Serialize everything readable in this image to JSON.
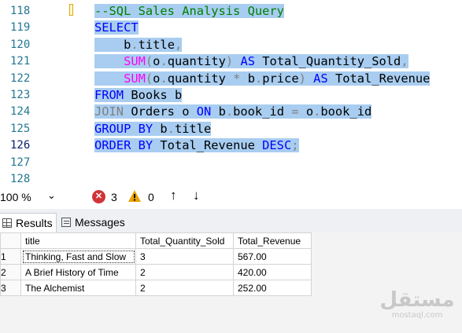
{
  "editor": {
    "line_numbers": [
      "118",
      "119",
      "120",
      "121",
      "122",
      "123",
      "124",
      "125",
      "126",
      "127",
      "128"
    ],
    "current_line": "126",
    "lines": [
      [
        {
          "t": "--SQL Sales Analysis Query",
          "c": "cm"
        }
      ],
      [
        {
          "t": "SELECT",
          "c": "kw"
        }
      ],
      [
        {
          "t": "    b",
          "c": ""
        },
        {
          "t": ".",
          "c": "op"
        },
        {
          "t": "title",
          "c": ""
        },
        {
          "t": ",",
          "c": "op"
        }
      ],
      [
        {
          "t": "    ",
          "c": ""
        },
        {
          "t": "SUM",
          "c": "fn"
        },
        {
          "t": "(",
          "c": "op"
        },
        {
          "t": "o",
          "c": ""
        },
        {
          "t": ".",
          "c": "op"
        },
        {
          "t": "quantity",
          "c": ""
        },
        {
          "t": ")",
          "c": "op"
        },
        {
          "t": " ",
          "c": ""
        },
        {
          "t": "AS",
          "c": "kw"
        },
        {
          "t": " Total_Quantity_Sold",
          "c": ""
        },
        {
          "t": ",",
          "c": "op"
        }
      ],
      [
        {
          "t": "    ",
          "c": ""
        },
        {
          "t": "SUM",
          "c": "fn"
        },
        {
          "t": "(",
          "c": "op"
        },
        {
          "t": "o",
          "c": ""
        },
        {
          "t": ".",
          "c": "op"
        },
        {
          "t": "quantity ",
          "c": ""
        },
        {
          "t": "*",
          "c": "op"
        },
        {
          "t": " b",
          "c": ""
        },
        {
          "t": ".",
          "c": "op"
        },
        {
          "t": "price",
          "c": ""
        },
        {
          "t": ")",
          "c": "op"
        },
        {
          "t": " ",
          "c": ""
        },
        {
          "t": "AS",
          "c": "kw"
        },
        {
          "t": " Total_Revenue",
          "c": ""
        }
      ],
      [
        {
          "t": "FROM",
          "c": "kw"
        },
        {
          "t": " Books b",
          "c": ""
        }
      ],
      [
        {
          "t": "JOIN",
          "c": "op"
        },
        {
          "t": " Orders o ",
          "c": ""
        },
        {
          "t": "ON",
          "c": "kw"
        },
        {
          "t": " b",
          "c": ""
        },
        {
          "t": ".",
          "c": "op"
        },
        {
          "t": "book_id ",
          "c": ""
        },
        {
          "t": "=",
          "c": "op"
        },
        {
          "t": " o",
          "c": ""
        },
        {
          "t": ".",
          "c": "op"
        },
        {
          "t": "book_id",
          "c": ""
        }
      ],
      [
        {
          "t": "GROUP BY",
          "c": "kw"
        },
        {
          "t": " b",
          "c": ""
        },
        {
          "t": ".",
          "c": "op"
        },
        {
          "t": "title",
          "c": ""
        }
      ],
      [
        {
          "t": "ORDER BY",
          "c": "kw"
        },
        {
          "t": " Total_Revenue ",
          "c": ""
        },
        {
          "t": "DESC",
          "c": "kw"
        },
        {
          "t": ";",
          "c": "op"
        }
      ],
      [],
      []
    ]
  },
  "status": {
    "zoom": "100 %",
    "error_count": "3",
    "warning_count": "0",
    "error_glyph": "✕",
    "up_glyph": "↑",
    "down_glyph": "↓",
    "chevron_glyph": "⌄"
  },
  "tabs": {
    "results_label": "Results",
    "messages_label": "Messages"
  },
  "results": {
    "columns": [
      "title",
      "Total_Quantity_Sold",
      "Total_Revenue"
    ],
    "rows": [
      {
        "n": "1",
        "title": "Thinking, Fast and Slow",
        "qty": "3",
        "rev": "567.00"
      },
      {
        "n": "2",
        "title": "A Brief History of Time",
        "qty": "2",
        "rev": "420.00"
      },
      {
        "n": "3",
        "title": "The Alchemist",
        "qty": "2",
        "rev": "252.00"
      }
    ]
  },
  "watermark": {
    "arabic": "مستقل",
    "latin": "mostaql.com"
  },
  "colors": {
    "selection": "#a8cdf0",
    "keyword": "#0000ff",
    "function": "#ff00ff",
    "comment": "#008000",
    "line_number": "#237893",
    "error": "#d13438",
    "warning": "#e8a200"
  }
}
